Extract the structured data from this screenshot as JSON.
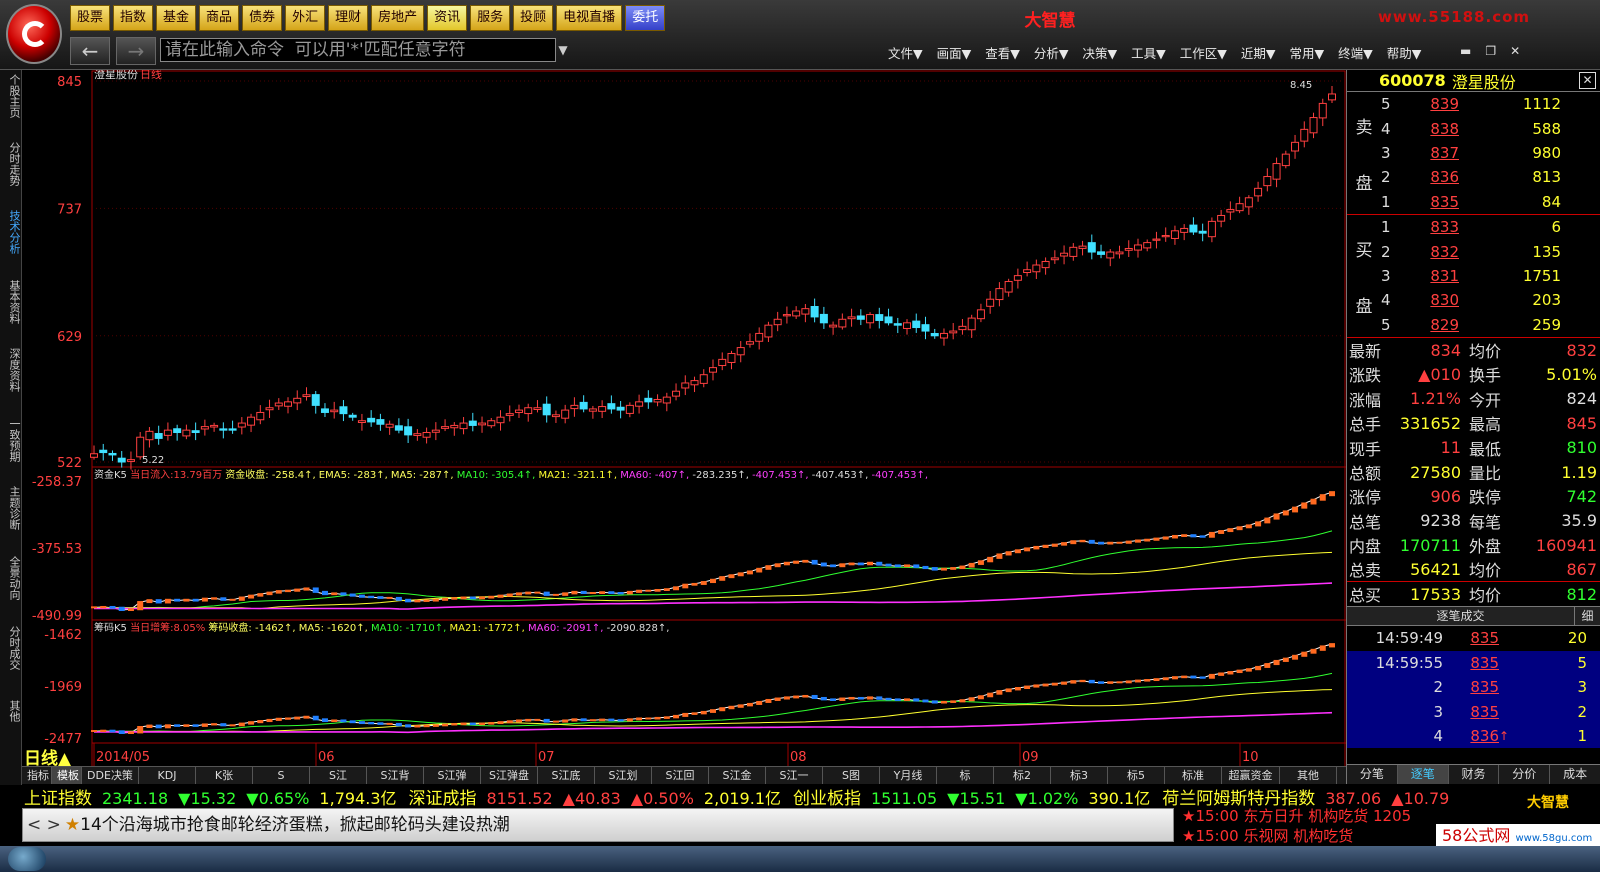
{
  "app": {
    "title": "大智慧",
    "brand_url": "www.55188.com",
    "nav_buttons": [
      "股票",
      "指数",
      "基金",
      "商品",
      "债券",
      "外汇",
      "理财",
      "房地产",
      "资讯",
      "服务",
      "投顾",
      "电视直播",
      "委托"
    ],
    "command_placeholder": "请在此输入命令  可以用'*'匹配任意字符",
    "menus": [
      "文件▼",
      "画面▼",
      "查看▼",
      "分析▼",
      "决策▼",
      "工具▼",
      "工作区▼",
      "近期▼",
      "常用▼",
      "终端▼",
      "帮助▼"
    ]
  },
  "left_tabs": [
    "个股主页",
    "分时走势",
    "技术分析",
    "基本资料",
    "深度资料",
    "一致预期",
    "主题诊断",
    "全景动向",
    "分时成交",
    "其他"
  ],
  "chart": {
    "main_title": "澄星股份",
    "period": "日线",
    "y_ticks": [
      "845",
      "737",
      "629",
      "522"
    ],
    "y_values": [
      845,
      737,
      629,
      522
    ],
    "high_label": "8.45",
    "low_label": "5.22",
    "x_labels": [
      "2014/05",
      "06",
      "07",
      "08",
      "09",
      "10"
    ],
    "ind1": {
      "name": "资金K5",
      "flow": "当日流入:13.79百万",
      "label": "资金收盘: -258.4↑, EMA5: -283↑, MA5: -287↑,",
      "ma10": "MA10: -305.4↑,",
      "ma21": "MA21: -321.1↑,",
      "ma60": "MA60: -407↑,",
      "rest": "-283.235↑,",
      "extra1": "-407.453↑,",
      "extra2": "-407.453↑,",
      "extra3": "-407.453↑,",
      "y_ticks": [
        "-258.37",
        "-375.53",
        "-490.99"
      ]
    },
    "ind2": {
      "name": "筹码K5",
      "flow": "当日增筹:8.05%",
      "label": "筹码收盘: -1462↑, MA5: -1620↑,",
      "ma10": "MA10: -1710↑,",
      "ma21": "MA21: -1772↑,",
      "ma60": "MA60: -2091↑,",
      "rest": "-2090.828↑,",
      "y_ticks": [
        "-1462",
        "-1969",
        "-2477"
      ]
    }
  },
  "chart_data": {
    "type": "candlestick",
    "title": "澄星股份",
    "period": "日线",
    "ylim": [
      522,
      845
    ],
    "y_ticks": [
      845,
      737,
      629,
      522
    ],
    "x_labels": [
      "2014/05",
      "06",
      "07",
      "08",
      "09",
      "10"
    ],
    "close": [
      529,
      530,
      528,
      522,
      524,
      543,
      548,
      542,
      549,
      547,
      549,
      547,
      552,
      553,
      549,
      549,
      555,
      560,
      564,
      568,
      572,
      573,
      576,
      579,
      570,
      564,
      566,
      563,
      560,
      557,
      556,
      554,
      554,
      549,
      545,
      546,
      547,
      549,
      552,
      553,
      555,
      553,
      555,
      557,
      560,
      563,
      566,
      568,
      568,
      562,
      562,
      566,
      570,
      567,
      567,
      569,
      567,
      566,
      570,
      573,
      573,
      575,
      577,
      582,
      589,
      591,
      596,
      602,
      609,
      614,
      619,
      624,
      631,
      638,
      643,
      647,
      650,
      652,
      645,
      640,
      638,
      643,
      645,
      643,
      647,
      642,
      640,
      638,
      640,
      636,
      633,
      629,
      631,
      633,
      637,
      644,
      651,
      660,
      669,
      675,
      680,
      685,
      689,
      692,
      695,
      699,
      704,
      705,
      700,
      698,
      700,
      700,
      703,
      706,
      708,
      711,
      714,
      718,
      720,
      717,
      716,
      726,
      731,
      736,
      741,
      746,
      754,
      764,
      775,
      783,
      793,
      804,
      814,
      826,
      834
    ]
  },
  "bottom_tabs": [
    "指标",
    "模板",
    "DDE决策",
    "KDJ",
    "K张",
    "S",
    "S江",
    "S江背",
    "S江弹",
    "S江弹盘",
    "S江底",
    "S江划",
    "S江回",
    "S江金",
    "S江一",
    "S图",
    "Y月线",
    "标",
    "标2",
    "标3",
    "标5",
    "标准",
    "超赢资金",
    "其他"
  ],
  "ticker": [
    {
      "name": "上证指数",
      "price": "2341.18",
      "chg": "▼15.32",
      "pct": "▼0.65%",
      "amt": "1,794.3亿"
    },
    {
      "name": "深证成指",
      "price": "8151.52",
      "chg": "▲40.83",
      "pct": "▲0.50%",
      "amt": "2,019.1亿"
    },
    {
      "name": "创业板指",
      "price": "1511.05",
      "chg": "▼15.51",
      "pct": "▼1.02%",
      "amt": "390.1亿"
    },
    {
      "name": "荷兰阿姆斯特丹指数",
      "price": "387.06",
      "chg": "▲10.79",
      "pct": "",
      "amt": ""
    }
  ],
  "news": "14个沿海城市抢食邮轮经济蛋糕，掀起邮轮码头建设热潮",
  "news_right": [
    "★15:00 东方日升 机构吃货 1205",
    "★15:00 乐视网  机构吃货"
  ],
  "brand2": "大智慧",
  "watermark": "58公式网",
  "watermark_url": "www.58gu.com",
  "quote": {
    "code": "600078",
    "name": "澄星股份",
    "sell_label": [
      "卖",
      "盘"
    ],
    "buy_label": [
      "买",
      "盘"
    ],
    "sell": [
      {
        "lvl": "5",
        "price": "839",
        "vol": "1112"
      },
      {
        "lvl": "4",
        "price": "838",
        "vol": "588"
      },
      {
        "lvl": "3",
        "price": "837",
        "vol": "980"
      },
      {
        "lvl": "2",
        "price": "836",
        "vol": "813"
      },
      {
        "lvl": "1",
        "price": "835",
        "vol": "84"
      }
    ],
    "buy": [
      {
        "lvl": "1",
        "price": "833",
        "vol": "6"
      },
      {
        "lvl": "2",
        "price": "832",
        "vol": "135"
      },
      {
        "lvl": "3",
        "price": "831",
        "vol": "1751"
      },
      {
        "lvl": "4",
        "price": "830",
        "vol": "203"
      },
      {
        "lvl": "5",
        "price": "829",
        "vol": "259"
      }
    ],
    "stats": [
      {
        "k": "最新",
        "v": "834",
        "vc": "red",
        "k2": "均价",
        "v2": "832",
        "v2c": "red"
      },
      {
        "k": "涨跌",
        "v": "▲010",
        "vc": "red",
        "k2": "换手",
        "v2": "5.01%",
        "v2c": "yellow"
      },
      {
        "k": "涨幅",
        "v": "1.21%",
        "vc": "red",
        "k2": "今开",
        "v2": "824",
        "v2c": "white"
      },
      {
        "k": "总手",
        "v": "331652",
        "vc": "yellow",
        "k2": "最高",
        "v2": "845",
        "v2c": "red"
      },
      {
        "k": "现手",
        "v": "11",
        "vc": "red",
        "k2": "最低",
        "v2": "810",
        "v2c": "green"
      },
      {
        "k": "总额",
        "v": "27580",
        "vc": "yellow",
        "k2": "量比",
        "v2": "1.19",
        "v2c": "yellow"
      },
      {
        "k": "涨停",
        "v": "906",
        "vc": "red",
        "k2": "跌停",
        "v2": "742",
        "v2c": "green"
      },
      {
        "k": "总笔",
        "v": "9238",
        "vc": "white",
        "k2": "每笔",
        "v2": "35.9",
        "v2c": "white"
      },
      {
        "k": "内盘",
        "v": "170711",
        "vc": "green",
        "k2": "外盘",
        "v2": "160941",
        "v2c": "red"
      },
      {
        "k": "总卖",
        "v": "56421",
        "vc": "yellow",
        "k2": "均价",
        "v2": "867",
        "v2c": "red"
      },
      {
        "k": "总买",
        "v": "17533",
        "vc": "yellow",
        "k2": "均价",
        "v2": "812",
        "v2c": "green"
      }
    ],
    "ticks_title": "逐笔成交",
    "ticks_title2": "细",
    "ticks": [
      {
        "t": "14:59:49",
        "p": "835",
        "a": "",
        "q": "20"
      },
      {
        "t": "14:59:55",
        "p": "835",
        "a": "",
        "q": "5"
      },
      {
        "t": "2",
        "p": "835",
        "a": "",
        "q": "3"
      },
      {
        "t": "3",
        "p": "835",
        "a": "",
        "q": "2"
      },
      {
        "t": "4",
        "p": "836",
        "a": "↑",
        "q": "1"
      }
    ],
    "tabs": [
      "分笔",
      "逐笔",
      "财务",
      "分价",
      "成本"
    ]
  }
}
